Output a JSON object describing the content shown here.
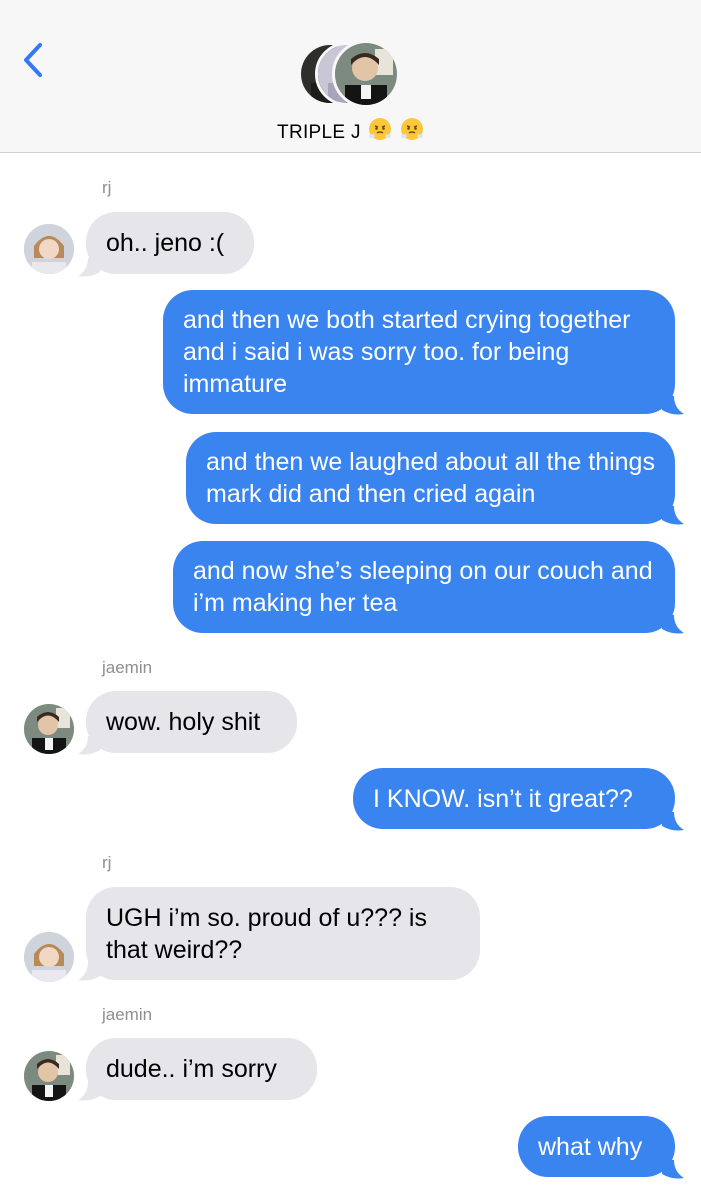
{
  "header": {
    "group_name": "TRIPLE J",
    "emojis": [
      "😤",
      "😤"
    ]
  },
  "messages": [
    {
      "sender": "rj",
      "text": "oh.. jeno :(",
      "direction": "incoming"
    },
    {
      "text": "and then we both started crying together and i said i was sorry too. for being immature",
      "direction": "outgoing"
    },
    {
      "text": "and then we laughed about all the things mark did and then cried again",
      "direction": "outgoing"
    },
    {
      "text": "and now she’s sleeping on our couch and i’m making her tea",
      "direction": "outgoing"
    },
    {
      "sender": "jaemin",
      "text": "wow. holy shit",
      "direction": "incoming"
    },
    {
      "text": "I KNOW. isn’t it great??",
      "direction": "outgoing"
    },
    {
      "sender": "rj",
      "text": "UGH i’m so. proud of u??? is that weird??",
      "direction": "incoming"
    },
    {
      "sender": "jaemin",
      "text": "dude.. i’m sorry",
      "direction": "incoming"
    },
    {
      "text": "what why",
      "direction": "outgoing"
    }
  ],
  "colors": {
    "outgoing_bubble": "#3984ef",
    "incoming_bubble": "#e5e5ea",
    "accent": "#3478f6",
    "sender_label": "#8e8e93"
  }
}
